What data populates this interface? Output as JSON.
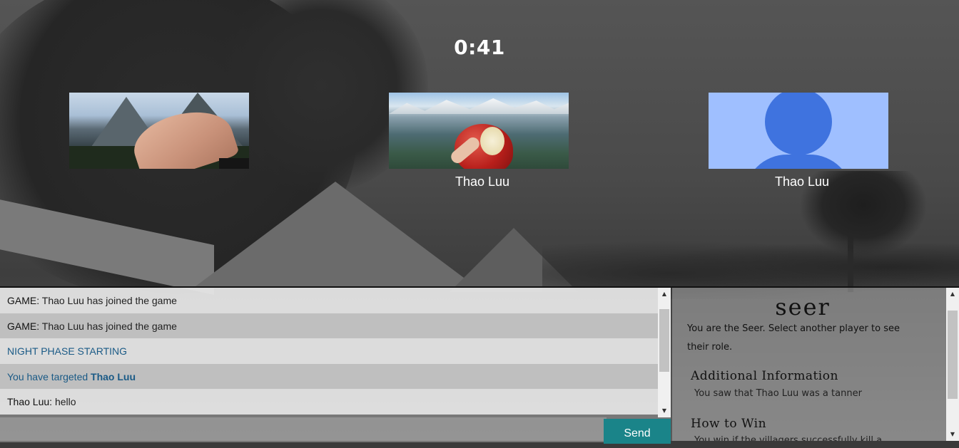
{
  "timer": "0:41",
  "players": [
    {
      "name": "",
      "picture": "mountain-hand-photo"
    },
    {
      "name": "Thao Luu",
      "picture": "apple-mountain-photo"
    },
    {
      "name": "Thao Luu",
      "picture": "default-avatar"
    }
  ],
  "chat": {
    "messages": [
      {
        "sender": "GAME:",
        "text": " Thao Luu has joined the game"
      },
      {
        "sender": "GAME:",
        "text": " Thao Luu has joined the game"
      },
      {
        "text": "NIGHT PHASE STARTING"
      },
      {
        "text": "You have targeted ",
        "target": "Thao Luu"
      },
      {
        "sender": "Thao Luu:",
        "text": " hello"
      }
    ],
    "input_value": "",
    "send_label": "Send"
  },
  "role": {
    "title": "seer",
    "description": "You are the Seer. Select another player to see their role.",
    "additional_heading": "Additional Information",
    "additional_text": "You saw that Thao Luu was a tanner",
    "howto_heading": "How to Win",
    "howto_text": "You win if the villagers successfully kill a"
  },
  "colors": {
    "send_button": "#1a8489",
    "system_message": "#1a5a86",
    "avatar_bg": "#9fbfff",
    "avatar_fg": "#3f73df"
  }
}
